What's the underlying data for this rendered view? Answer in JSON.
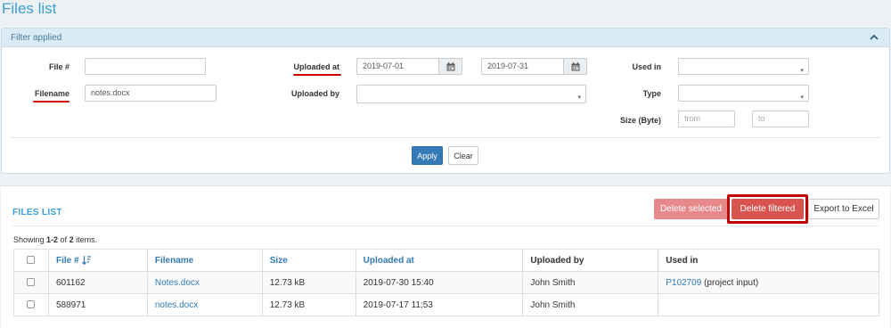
{
  "page_title": "Files list",
  "filter": {
    "header": "Filter applied",
    "file_no_label": "File #",
    "file_no_value": "",
    "filename_label": "Filename",
    "filename_value": "notes.docx",
    "uploaded_at_label": "Uploaded at",
    "uploaded_from": "2019-07-01",
    "uploaded_to": "2019-07-31",
    "uploaded_by_label": "Uploaded by",
    "uploaded_by_value": "",
    "used_in_label": "Used in",
    "used_in_value": "",
    "type_label": "Type",
    "type_value": "",
    "size_label": "Size (Byte)",
    "size_from_placeholder": "from",
    "size_to_placeholder": "to",
    "apply": "Apply",
    "clear": "Clear"
  },
  "files": {
    "title": "FILES LIST",
    "delete_selected": "Delete selected",
    "delete_filtered": "Delete filtered",
    "export": "Export to Excel",
    "summary_prefix": "Showing ",
    "summary_range": "1-2",
    "summary_mid": " of ",
    "summary_total": "2",
    "summary_suffix": " items.",
    "columns": [
      "File #",
      "Filename",
      "Size",
      "Uploaded at",
      "Uploaded by",
      "Used in"
    ],
    "rows": [
      {
        "file_no": "601162",
        "filename": "Notes.docx",
        "size": "12.73 kB",
        "uploaded_at": "2019-07-30 15:40",
        "uploaded_by": "John Smith",
        "used_in_link": "P102709",
        "used_in_text": " (project input)"
      },
      {
        "file_no": "588971",
        "filename": "notes.docx",
        "size": "12.73 kB",
        "uploaded_at": "2019-07-17 11:53",
        "uploaded_by": "John Smith",
        "used_in_link": "",
        "used_in_text": ""
      }
    ]
  },
  "colors": {
    "accent": "#3a9fd5",
    "primary": "#337ab7",
    "danger": "#d9534f",
    "danger_light": "#e7898a",
    "highlight": "#c30000"
  }
}
